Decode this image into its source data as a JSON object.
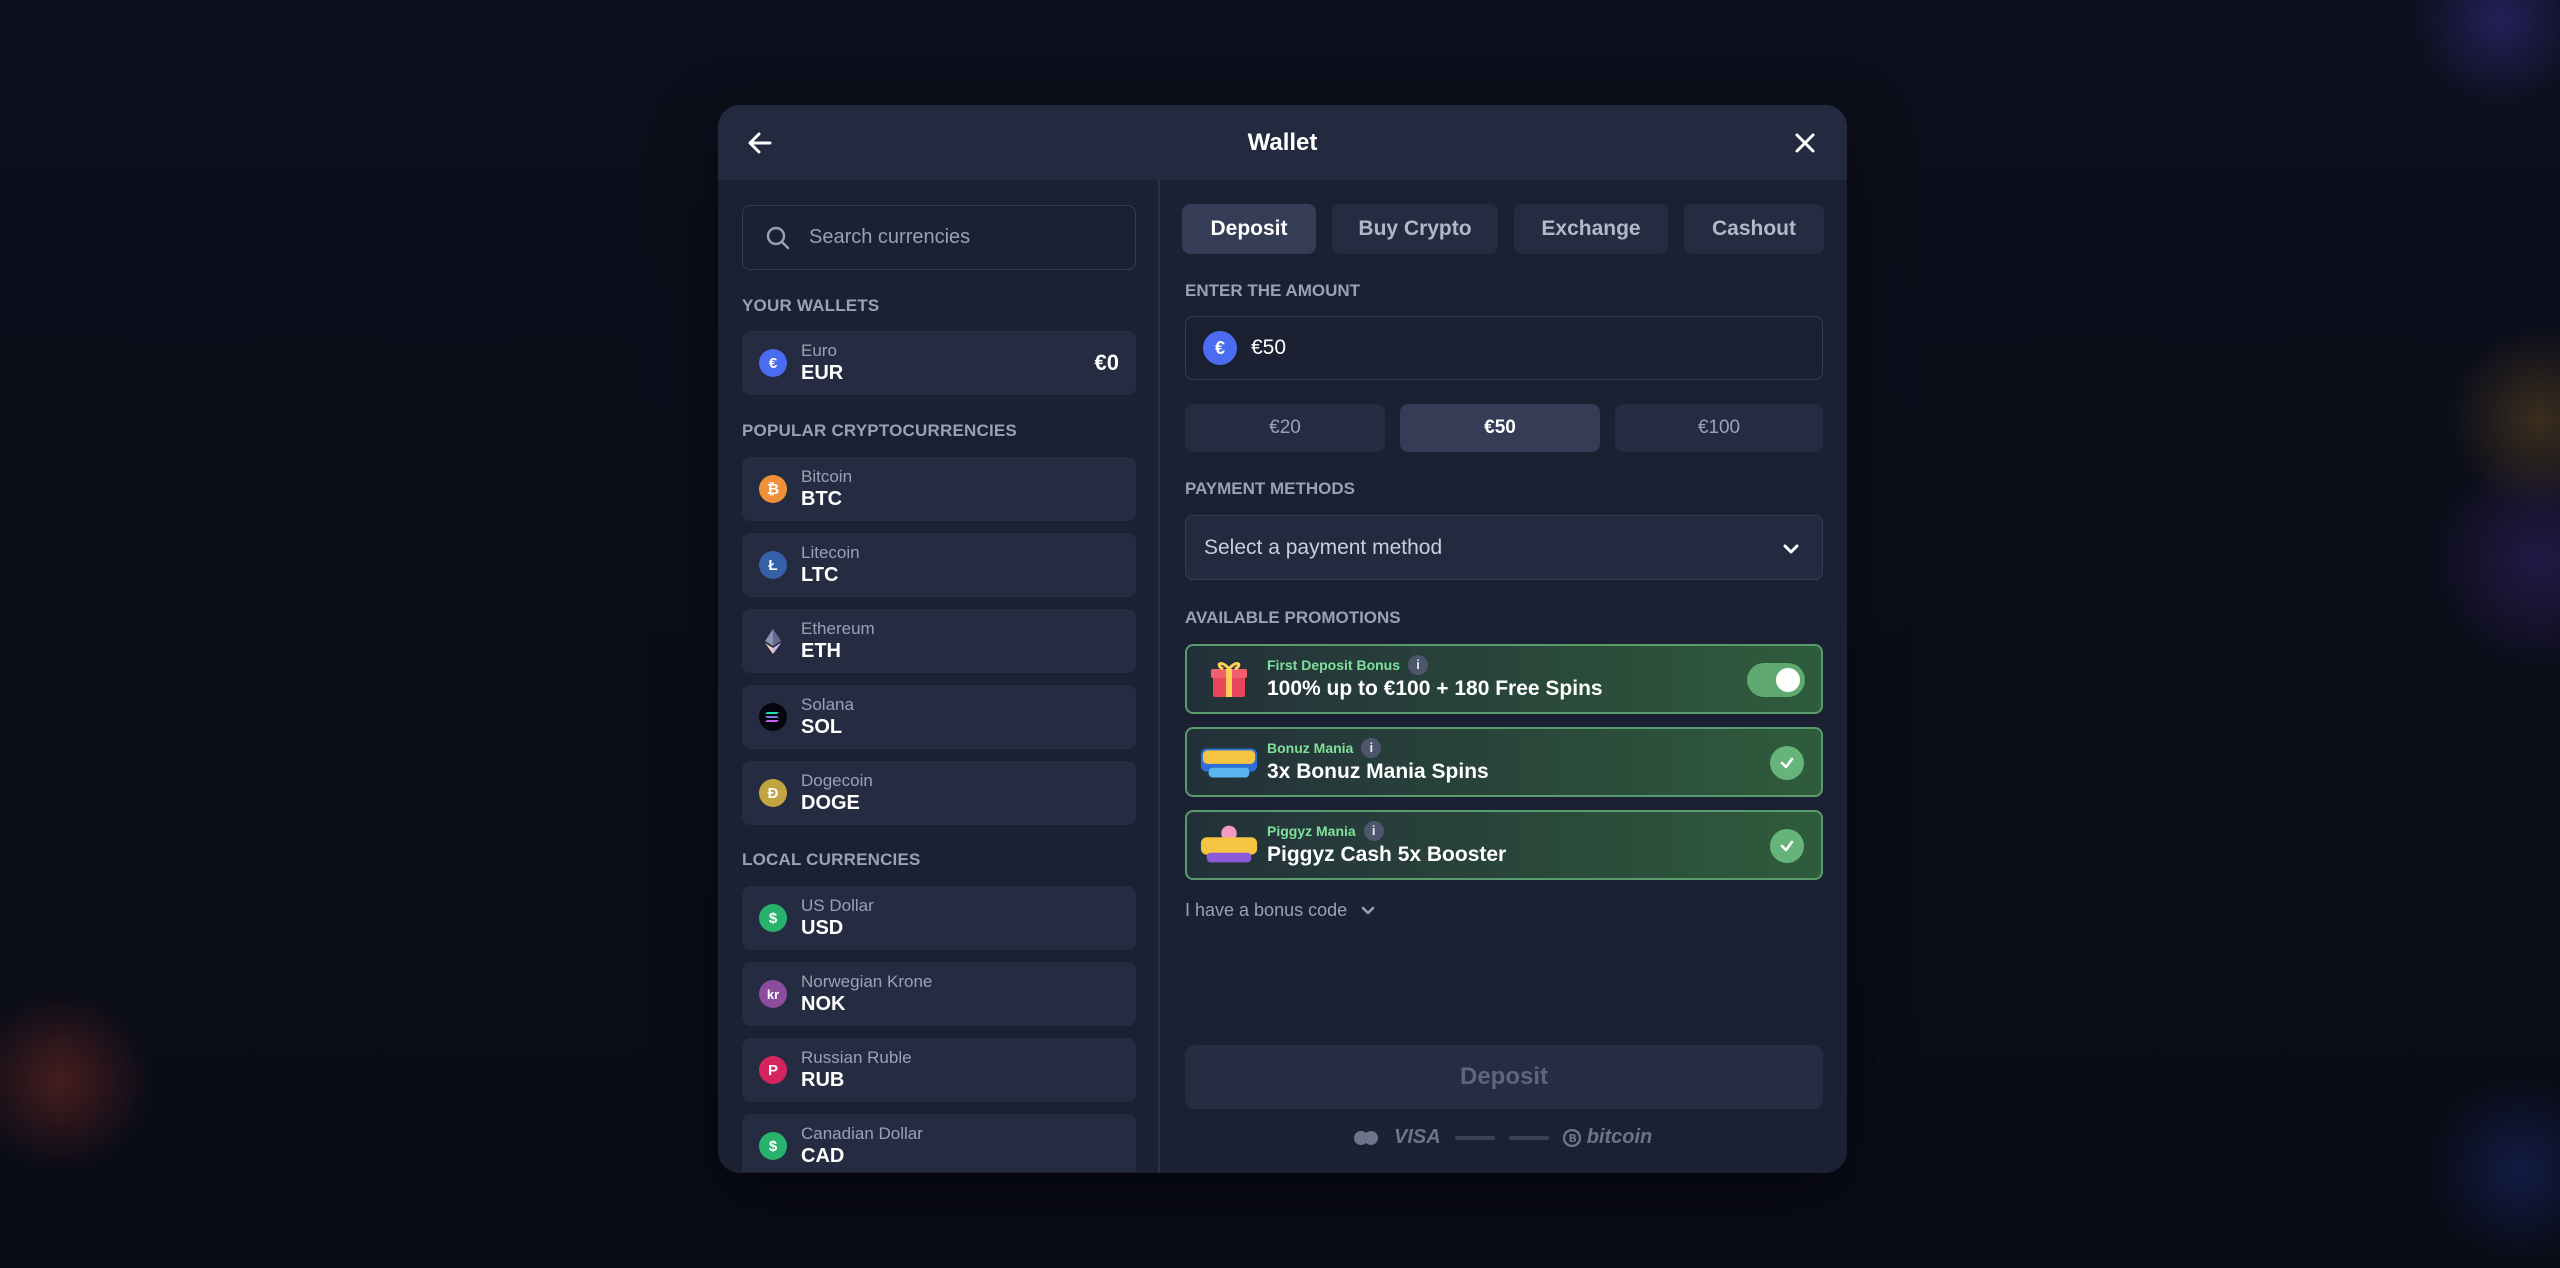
{
  "modal": {
    "title": "Wallet"
  },
  "search": {
    "placeholder": "Search currencies"
  },
  "sections": {
    "your_wallets": "YOUR WALLETS",
    "popular": "POPULAR CRYPTOCURRENCIES",
    "local": "LOCAL CURRENCIES"
  },
  "wallets": [
    {
      "name": "Euro",
      "code": "EUR",
      "balance": "€0",
      "symbol": "€",
      "color": "#4a6cf0"
    }
  ],
  "popular": [
    {
      "name": "Bitcoin",
      "code": "BTC",
      "symbol": "₿",
      "color": "#f0913a"
    },
    {
      "name": "Litecoin",
      "code": "LTC",
      "symbol": "Ł",
      "color": "#3660a8"
    },
    {
      "name": "Ethereum",
      "code": "ETH",
      "symbol": "◆",
      "color": "#252b40"
    },
    {
      "name": "Solana",
      "code": "SOL",
      "symbol": "≡",
      "color": "#0a0a14"
    },
    {
      "name": "Dogecoin",
      "code": "DOGE",
      "symbol": "Ð",
      "color": "#c2a443"
    }
  ],
  "local": [
    {
      "name": "US Dollar",
      "code": "USD",
      "symbol": "$",
      "color": "#27b36b"
    },
    {
      "name": "Norwegian Krone",
      "code": "NOK",
      "symbol": "kr",
      "color": "#8b4c9e"
    },
    {
      "name": "Russian Ruble",
      "code": "RUB",
      "symbol": "P",
      "color": "#d6245f"
    },
    {
      "name": "Canadian Dollar",
      "code": "CAD",
      "symbol": "$",
      "color": "#27b36b"
    }
  ],
  "tabs": [
    "Deposit",
    "Buy Crypto",
    "Exchange",
    "Cashout"
  ],
  "amount": {
    "label": "ENTER THE AMOUNT",
    "value": "€50",
    "quick": [
      "€20",
      "€50",
      "€100"
    ]
  },
  "payment": {
    "label": "PAYMENT METHODS",
    "placeholder": "Select a payment method"
  },
  "promotions": {
    "label": "AVAILABLE PROMOTIONS",
    "items": [
      {
        "tag": "First Deposit Bonus",
        "title": "100% up to €100 + 180 Free Spins",
        "control": "toggle",
        "enabled": true
      },
      {
        "tag": "Bonuz Mania",
        "title": "3x Bonuz Mania Spins",
        "control": "check",
        "enabled": true
      },
      {
        "tag": "Piggyz Mania",
        "title": "Piggyz Cash 5x Booster",
        "control": "check",
        "enabled": true
      }
    ]
  },
  "bonus_code": "I have a bonus code",
  "deposit_button": "Deposit",
  "payment_logos": {
    "visa": "VISA",
    "bitcoin": "bitcoin"
  }
}
